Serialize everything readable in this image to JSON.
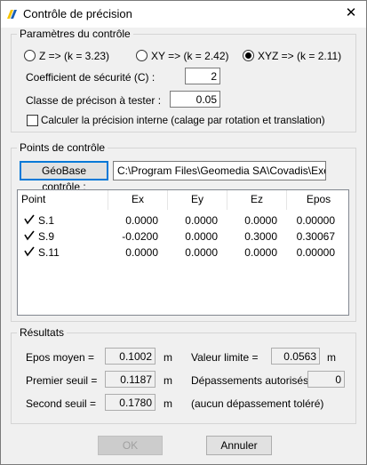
{
  "window": {
    "title": "Contrôle de précision",
    "close_glyph": "✕",
    "icon": "app-icon",
    "icon_colors": [
      "#f5c400",
      "#1a5fb4"
    ]
  },
  "params": {
    "legend": "Paramètres du contrôle",
    "radio_z": "Z     => (k = 3.23)",
    "radio_xy": "XY    => (k = 2.42)",
    "radio_xyz": "XYZ => (k = 2.11)",
    "selected": "XYZ",
    "coef_label": "Coefficient de sécurité (C) :",
    "coef_value": "2",
    "classe_label": "Classe de précison à tester :",
    "classe_value": "0.05",
    "calc_label": "Calculer la précision interne (calage par rotation et translation)",
    "calc_checked": false
  },
  "points": {
    "legend": "Points de contrôle",
    "geobase_button": "GéoBase contrôle :",
    "geobase_path": "C:\\Program Files\\Geomedia SA\\Covadis\\Exemples\\Calcul",
    "columns": [
      "Point",
      "Ex",
      "Ey",
      "Ez",
      "Epos"
    ],
    "rows": [
      {
        "point": "S.1",
        "ex": "0.0000",
        "ey": "0.0000",
        "ez": "0.0000",
        "epos": "0.00000",
        "checked": true
      },
      {
        "point": "S.9",
        "ex": "-0.0200",
        "ey": "0.0000",
        "ez": "0.3000",
        "epos": "0.30067",
        "checked": true
      },
      {
        "point": "S.11",
        "ex": "0.0000",
        "ey": "0.0000",
        "ez": "0.0000",
        "epos": "0.00000",
        "checked": true
      }
    ]
  },
  "results": {
    "legend": "Résultats",
    "epos_label": "Epos moyen =",
    "epos_value": "0.1002",
    "epos_unit": "m",
    "premier_label": "Premier seuil =",
    "premier_value": "0.1187",
    "premier_unit": "m",
    "second_label": "Second seuil =",
    "second_value": "0.1780",
    "second_unit": "m",
    "limite_label": "Valeur limite =",
    "limite_value": "0.0563",
    "limite_unit": "m",
    "depass_label": "Dépassements autorisés =",
    "depass_value": "0",
    "tolere_text": "(aucun dépassement toléré)"
  },
  "buttons": {
    "ok": "OK",
    "cancel": "Annuler"
  }
}
